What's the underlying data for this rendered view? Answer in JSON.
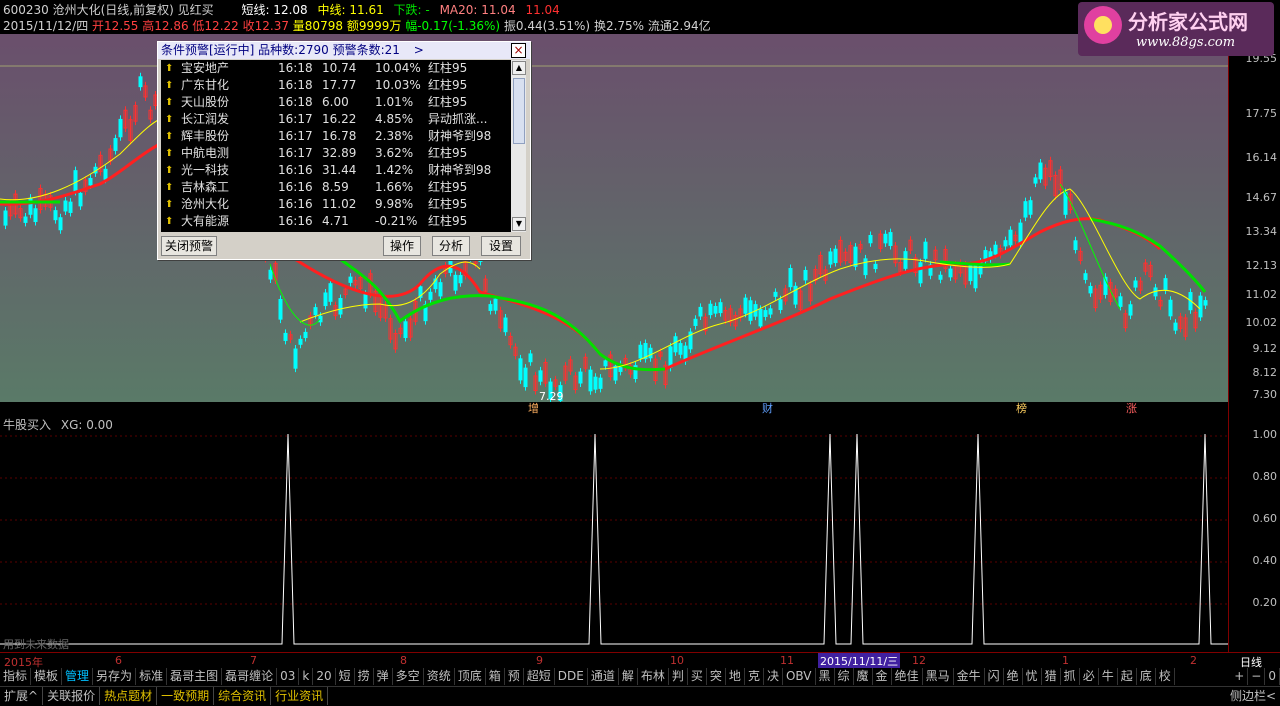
{
  "quote": {
    "line1_prefix": "600230 沧州大化(日线,前复权) 见红买",
    "short_label": "短线: 12.08",
    "mid_label": "中线: 11.61",
    "down_label": "下跌: -",
    "ma20_label": "MA20: 11.04",
    "ma20_value": "11.04",
    "line2_date": "2015/11/12/四",
    "open": "开12.55",
    "high": "高12.86",
    "low": "低12.22",
    "close": "收12.37",
    "volume": "量80798",
    "amount": "额9999万",
    "change": "幅-0.17(-1.36%)",
    "amplitude": "振0.44(3.51%)",
    "turnover": "换2.75%",
    "float_cap": "流通2.94亿"
  },
  "logo": {
    "title": "分析家公式网",
    "url": "www.88gs.com"
  },
  "price_axis": [
    "19.55",
    "17.75",
    "16.14",
    "14.67",
    "13.34",
    "12.13",
    "11.02",
    "10.02",
    "9.12",
    "8.12",
    "7.30"
  ],
  "annotations": {
    "low_price": "7.29",
    "event_markers": [
      "增",
      "财",
      "榜",
      "涨"
    ]
  },
  "indicator": {
    "title": "牛股买入",
    "xg_label": "XG: 0.00",
    "axis": [
      "1.00",
      "0.80",
      "0.60",
      "0.40",
      "0.20"
    ],
    "future_note": "用到未来数据",
    "signal_x": [
      288,
      595,
      830,
      857,
      978,
      1205
    ]
  },
  "date_axis": [
    "2015年",
    "6",
    "7",
    "8",
    "9",
    "10",
    "11",
    "2015/11/11/三",
    "12",
    "1",
    "2"
  ],
  "period_label": "日线",
  "alert": {
    "title": "条件预警[运行中] 品种数:2790 预警条数:21",
    "nav": ">",
    "close": "×",
    "rows": [
      {
        "name": "宝安地产",
        "time": "16:18",
        "price": "10.74",
        "pct": "10.04%",
        "cond": "红柱95"
      },
      {
        "name": "广东甘化",
        "time": "16:18",
        "price": "17.77",
        "pct": "10.03%",
        "cond": "红柱95"
      },
      {
        "name": "天山股份",
        "time": "16:18",
        "price": "6.00",
        "pct": "1.01%",
        "cond": "红柱95"
      },
      {
        "name": "长江润发",
        "time": "16:17",
        "price": "16.22",
        "pct": "4.85%",
        "cond": "异动抓涨..."
      },
      {
        "name": "辉丰股份",
        "time": "16:17",
        "price": "16.78",
        "pct": "2.38%",
        "cond": "财神爷到98"
      },
      {
        "name": "中航电测",
        "time": "16:17",
        "price": "32.89",
        "pct": "3.62%",
        "cond": "红柱95"
      },
      {
        "name": "光一科技",
        "time": "16:16",
        "price": "31.44",
        "pct": "1.42%",
        "cond": "财神爷到98"
      },
      {
        "name": "吉林森工",
        "time": "16:16",
        "price": "8.59",
        "pct": "1.66%",
        "cond": "红柱95"
      },
      {
        "name": "沧州大化",
        "time": "16:16",
        "price": "11.02",
        "pct": "9.98%",
        "cond": "红柱95"
      },
      {
        "name": "大有能源",
        "time": "16:16",
        "price": "4.71",
        "pct": "-0.21%",
        "cond": "红柱95"
      }
    ],
    "buttons": {
      "close_alert": "关闭预警",
      "operate": "操作",
      "analyze": "分析",
      "settings": "设置"
    }
  },
  "tabs_row1": [
    "指标",
    "模板",
    "管理",
    "另存为",
    "标准",
    "磊哥主图",
    "磊哥缠论",
    "03",
    "k",
    "20",
    "短",
    "捞",
    "弹",
    "多空",
    "资统",
    "顶底",
    "箱",
    "预",
    "超短",
    "DDE",
    "通道",
    "解",
    "布林",
    "判",
    "买",
    "突",
    "地",
    "克",
    "决",
    "OBV",
    "黑",
    "综",
    "魔",
    "金",
    "绝佳",
    "黑马",
    "金牛",
    "闪",
    "绝",
    "忧",
    "猎",
    "抓",
    "必",
    "牛",
    "起",
    "底",
    "校"
  ],
  "tabs_row1_right": [
    "+",
    "−",
    "0"
  ],
  "tabs_row2": [
    "扩展^",
    "关联报价",
    "热点题材",
    "一致预期",
    "综合资讯",
    "行业资讯"
  ],
  "tabs_row2_right": "侧边栏<",
  "colors": {
    "up": "#00ffff",
    "down": "#ff3030",
    "ma_red": "#ff2020",
    "ma_green": "#00e000",
    "ma_yellow": "#ffff00",
    "panel_top": "#6a506a",
    "panel_bottom": "#5c7a6a"
  }
}
